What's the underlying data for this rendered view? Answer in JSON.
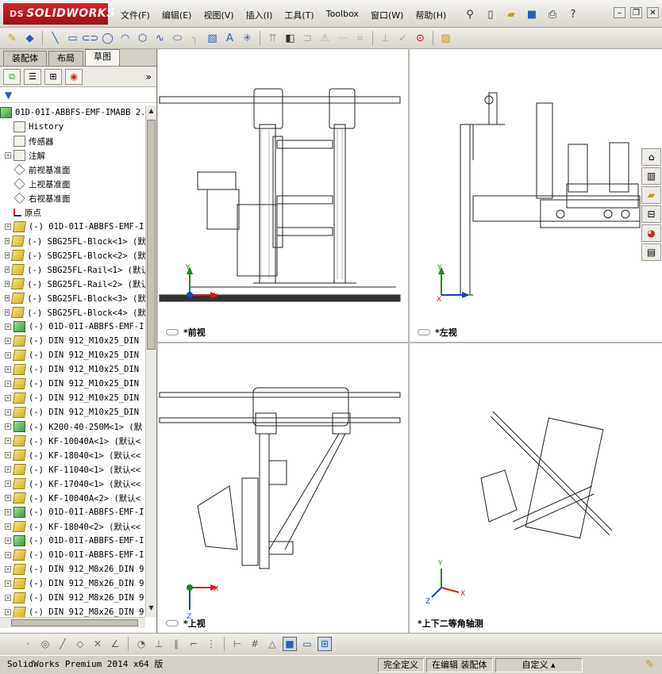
{
  "app": {
    "logo_text": "SOLIDWORKS",
    "logo_prefix": "DS"
  },
  "menu": [
    "文件(F)",
    "编辑(E)",
    "视图(V)",
    "插入(I)",
    "工具(T)",
    "Toolbox",
    "窗口(W)",
    "帮助(H)"
  ],
  "manager_tabs": [
    "装配体",
    "布局",
    "草图"
  ],
  "active_tab": "草图",
  "tree": {
    "root": "01D-01I-ABBFS-EMF-IMABB 2.:",
    "items": [
      {
        "label": "History",
        "icon": "history-icon",
        "plus": false
      },
      {
        "label": "传感器",
        "icon": "sensor-icon",
        "plus": false
      },
      {
        "label": "注解",
        "icon": "annotation-icon",
        "plus": true
      },
      {
        "label": "前视基准面",
        "icon": "plane-icon",
        "plus": false
      },
      {
        "label": "上视基准面",
        "icon": "plane-icon",
        "plus": false
      },
      {
        "label": "右视基准面",
        "icon": "plane-icon",
        "plus": false
      },
      {
        "label": "原点",
        "icon": "origin-icon",
        "plus": false
      },
      {
        "label": "(-) 01D-01I-ABBFS-EMF-I",
        "icon": "part-icon",
        "plus": true
      },
      {
        "label": "(-) SBG25FL-Block<1> (默",
        "icon": "part-icon",
        "plus": true
      },
      {
        "label": "(-) SBG25FL-Block<2> (默",
        "icon": "part-icon",
        "plus": true
      },
      {
        "label": "(-) SBG25FL-Rail<1> (默认",
        "icon": "part-icon",
        "plus": true
      },
      {
        "label": "(-) SBG25FL-Rail<2> (默认",
        "icon": "part-icon",
        "plus": true
      },
      {
        "label": "(-) SBG25FL-Block<3> (默",
        "icon": "part-icon",
        "plus": true
      },
      {
        "label": "(-) SBG25FL-Block<4> (默",
        "icon": "part-icon",
        "plus": true
      },
      {
        "label": "(-) 01D-01I-ABBFS-EMF-I",
        "icon": "assembly-icon",
        "plus": true
      },
      {
        "label": "(-) DIN 912_M10x25_DIN",
        "icon": "part-icon",
        "plus": true
      },
      {
        "label": "(-) DIN 912_M10x25_DIN",
        "icon": "part-icon",
        "plus": true
      },
      {
        "label": "(-) DIN 912_M10x25_DIN",
        "icon": "part-icon",
        "plus": true
      },
      {
        "label": "(-) DIN 912_M10x25_DIN",
        "icon": "part-icon",
        "plus": true
      },
      {
        "label": "(-) DIN 912_M10x25_DIN",
        "icon": "part-icon",
        "plus": true
      },
      {
        "label": "(-) DIN 912_M10x25_DIN",
        "icon": "part-icon",
        "plus": true
      },
      {
        "label": "(-) K200-40-250M<1> (默",
        "icon": "assembly-icon",
        "plus": true
      },
      {
        "label": "(-) KF-10040A<1> (默认<",
        "icon": "part-icon",
        "plus": true
      },
      {
        "label": "(-) KF-18040<1> (默认<<",
        "icon": "part-icon",
        "plus": true
      },
      {
        "label": "(-) KF-11040<1> (默认<<",
        "icon": "part-icon",
        "plus": true
      },
      {
        "label": "(-) KF-17040<1> (默认<<",
        "icon": "part-icon",
        "plus": true
      },
      {
        "label": "(-) KF-10040A<2> (默认<",
        "icon": "part-icon",
        "plus": true
      },
      {
        "label": "(-) 01D-01I-ABBFS-EMF-I",
        "icon": "assembly-icon",
        "plus": true
      },
      {
        "label": "(-) KF-18040<2> (默认<<",
        "icon": "part-icon",
        "plus": true
      },
      {
        "label": "(-) 01D-01I-ABBFS-EMF-I",
        "icon": "assembly-icon",
        "plus": true
      },
      {
        "label": "(-) 01D-01I-ABBFS-EMF-I",
        "icon": "part-icon",
        "plus": true
      },
      {
        "label": "(-) DIN 912_M8x26_DIN 9",
        "icon": "part-icon",
        "plus": true
      },
      {
        "label": "(-) DIN 912_M8x26_DIN 9",
        "icon": "part-icon",
        "plus": true
      },
      {
        "label": "(-) DIN 912_M8x26_DIN 9",
        "icon": "part-icon",
        "plus": true
      },
      {
        "label": "(-) DIN 912_M8x26_DIN 9",
        "icon": "part-icon",
        "plus": true
      }
    ]
  },
  "viewports": [
    {
      "name": "*前视",
      "id": "front"
    },
    {
      "name": "*左视",
      "id": "left"
    },
    {
      "name": "*上视",
      "id": "top"
    },
    {
      "name": "*上下二等角轴测",
      "id": "iso"
    }
  ],
  "axes": {
    "x": "X",
    "y": "Y",
    "z": "Z"
  },
  "status": {
    "app": "SolidWorks Premium 2014 x64 版",
    "definition": "完全定义",
    "editing": "在编辑 装配体",
    "units": "自定义"
  },
  "colors": {
    "brand": "#c2161c",
    "axis_x": "#d0201e",
    "axis_y": "#1f8a1f",
    "axis_z": "#1f3fc8"
  }
}
